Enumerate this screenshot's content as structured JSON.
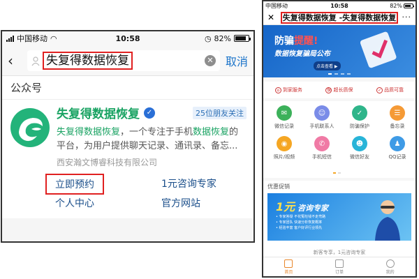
{
  "left": {
    "status": {
      "carrier": "中国移动",
      "time": "10:58",
      "battery": "82%",
      "battery_level": 0.82
    },
    "search": {
      "query": "失复得数据恢复",
      "cancel": "取消",
      "back": "‹"
    },
    "section_title": "公众号",
    "result": {
      "name": "失复得数据恢复",
      "badge": "25位朋友关注",
      "desc_hl1": "失复得数据恢复",
      "desc_mid": "，一个专注于手机",
      "desc_hl2": "数据恢复",
      "desc_end": "的平台，为用户提供聊天记录、通讯录、备忘...",
      "company": "西安瀚文博睿科技有限公司",
      "links": [
        "立即预约",
        "1元咨询专家",
        "个人中心",
        "官方网站"
      ]
    }
  },
  "right": {
    "status": {
      "carrier": "中国移动",
      "time": "10:58",
      "battery": "82%",
      "battery_level": 0.82
    },
    "title": "失复得数据恢复 -失复得数据恢复",
    "close": "✕",
    "more": "···",
    "banner": {
      "line1a": "防骗",
      "line1b": "提醒!",
      "line2": "数据恢复骗局公布",
      "button": "点击查看 ▶"
    },
    "trust": [
      "到家服务",
      "超长质保",
      "品质可靠"
    ],
    "services": [
      {
        "label": "微信记录",
        "color": "#3cb15a",
        "icon": "chat-icon"
      },
      {
        "label": "手机联系人",
        "color": "#7a8ce8",
        "icon": "contact-icon"
      },
      {
        "label": "防骗保护",
        "color": "#2fb58a",
        "icon": "shield-icon"
      },
      {
        "label": "备忘录",
        "color": "#f59a36",
        "icon": "memo-icon"
      },
      {
        "label": "照片/视频",
        "color": "#f5a623",
        "icon": "camera-icon"
      },
      {
        "label": "手机短信",
        "color": "#f07aa5",
        "icon": "sms-icon"
      },
      {
        "label": "微信好友",
        "color": "#28b4d8",
        "icon": "wechat-friends-icon"
      },
      {
        "label": "QQ记录",
        "color": "#3f9be6",
        "icon": "qq-icon"
      }
    ],
    "promo_title": "优惠促销",
    "promo": {
      "yuan": "1元",
      "consult": "咨询专家",
      "bullets": [
        "• 专家答疑  不花冤枉钱不走弯路",
        "• 专家团队  快速分析恢复概率",
        "• 经验丰富  客户好评行业领先"
      ]
    },
    "promo_sub": "新客专享，1元咨询专家",
    "tabs": [
      "首页",
      "订单",
      "我的"
    ]
  }
}
